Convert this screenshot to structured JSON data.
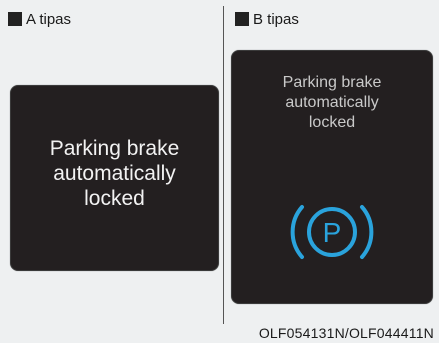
{
  "panel_a": {
    "label": "A tipas",
    "message_lines": [
      "Parking brake",
      "automatically",
      "locked"
    ]
  },
  "panel_b": {
    "label": "B tipas",
    "message_lines": [
      "Parking brake",
      "automatically",
      "locked"
    ],
    "icon": "parking-brake-icon",
    "icon_letter": "P",
    "icon_color": "#2aa3dc"
  },
  "colors": {
    "screen_background": "#231f20",
    "page_background": "#eef0f1"
  },
  "footer": {
    "figure_code": "OLF054131N/OLF044411N"
  }
}
